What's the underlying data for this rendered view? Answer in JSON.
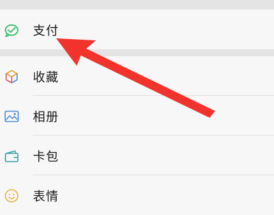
{
  "menu": {
    "items": [
      {
        "label": "支付",
        "icon": "wechat-pay-icon"
      },
      {
        "label": "收藏",
        "icon": "favorites-cube-icon"
      },
      {
        "label": "相册",
        "icon": "album-image-icon"
      },
      {
        "label": "卡包",
        "icon": "card-wallet-icon"
      },
      {
        "label": "表情",
        "icon": "emoji-smile-icon"
      }
    ]
  },
  "annotation": {
    "type": "arrow",
    "color": "#f2332d",
    "points_to": "支付"
  },
  "colors": {
    "background": "#ededed",
    "row_background": "#f7f7f7",
    "pay_icon": "#2fbf6a",
    "favorites_icon": "#e0a43b",
    "album_icon": "#4a8fd4",
    "card_icon": "#3aa3a3",
    "emoji_icon": "#e7b43f"
  }
}
